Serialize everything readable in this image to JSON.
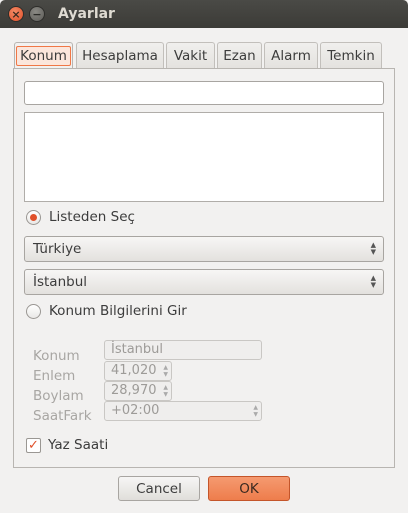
{
  "window": {
    "title": "Ayarlar"
  },
  "tabs": [
    {
      "label": "Konum"
    },
    {
      "label": "Hesaplama"
    },
    {
      "label": "Vakit"
    },
    {
      "label": "Ezan"
    },
    {
      "label": "Alarm"
    },
    {
      "label": "Temkin"
    }
  ],
  "search": {
    "value": ""
  },
  "location_from_list": {
    "label": "Listeden Seç",
    "selected": true,
    "country": "Türkiye",
    "city": "İstanbul"
  },
  "location_manual": {
    "label": "Konum Bilgilerini Gir",
    "selected": false,
    "fields": {
      "konum_label": "Konum",
      "konum_value": "İstanbul",
      "enlem_label": "Enlem",
      "enlem_value": "41,020",
      "boylam_label": "Boylam",
      "boylam_value": "28,970",
      "saatfark_label": "SaatFark",
      "saatfark_value": "+02:00"
    }
  },
  "dst": {
    "label": "Yaz Saati",
    "checked": true
  },
  "buttons": {
    "cancel": "Cancel",
    "ok": "OK"
  },
  "colors": {
    "accent": "#e0502a",
    "titlebar": "#3c3b37"
  }
}
